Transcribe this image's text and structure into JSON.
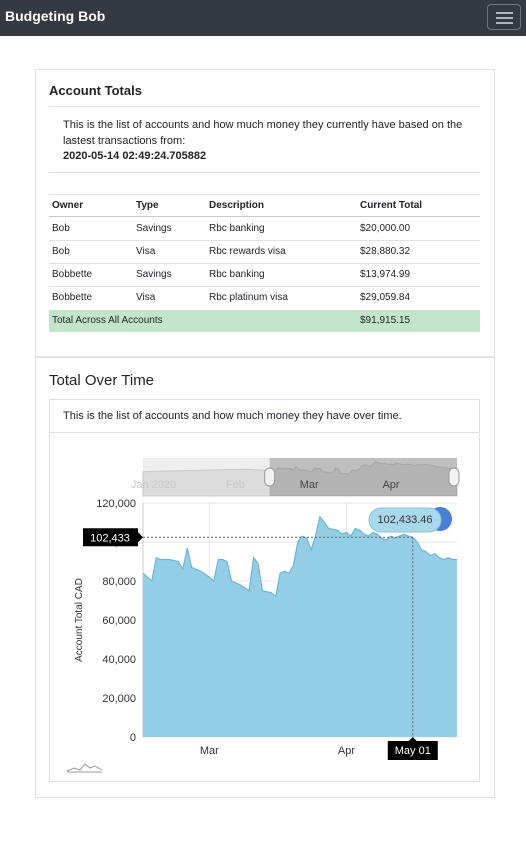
{
  "navbar": {
    "brand": "Budgeting Bob",
    "menu_icon": "hamburger-menu-icon"
  },
  "accounts": {
    "title": "Account Totals",
    "intro": "This is the list of accounts and how much money they currently have based on the lastest transactions from:",
    "timestamp": "2020-05-14 02:49:24.705882",
    "columns": [
      "Owner",
      "Type",
      "Description",
      "Current Total"
    ],
    "rows": [
      {
        "owner": "Bob",
        "type": "Savings",
        "description": "Rbc banking",
        "total": "$20,000.00"
      },
      {
        "owner": "Bob",
        "type": "Visa",
        "description": "Rbc rewards visa",
        "total": "$28,880.32"
      },
      {
        "owner": "Bobbette",
        "type": "Savings",
        "description": "Rbc banking",
        "total": "$13,974.99"
      },
      {
        "owner": "Bobbette",
        "type": "Visa",
        "description": "Rbc platinum visa",
        "total": "$29,059.84"
      }
    ],
    "total_label": "Total Across All Accounts",
    "total_value": "$91,915.15",
    "total_color": "#c3e6cb"
  },
  "overtime": {
    "title": "Total Over Time",
    "intro": "This is the list of accounts and how much money they have over time."
  },
  "chart_data": {
    "type": "area",
    "ylabel": "Account Total CAD",
    "xlabel": "",
    "yticks": [
      "120,000",
      "100,000",
      "80,000",
      "60,000",
      "40,000",
      "20,000",
      "0"
    ],
    "ylim": [
      0,
      120000
    ],
    "xtick_labels": [
      {
        "label": "Mar",
        "day": 35
      },
      {
        "label": "Apr",
        "day": 66
      }
    ],
    "navigator_labels": [
      {
        "label": "Jan 2020",
        "day": -24
      },
      {
        "label": "Feb",
        "day": 7
      },
      {
        "label": "Mar",
        "day": 35
      },
      {
        "label": "Apr",
        "day": 66
      }
    ],
    "crosshair": {
      "y_label": "102,433",
      "x_label": "May 01",
      "tooltip": "102,433.46",
      "day": 81
    },
    "fill_color": "#94cee6",
    "line_color": "#6bb6d8",
    "grid": true,
    "series": [
      {
        "points": [
          [
            20,
            84000
          ],
          [
            21,
            82000
          ],
          [
            22,
            80000
          ],
          [
            23,
            92000
          ],
          [
            24,
            91000
          ],
          [
            26,
            91000
          ],
          [
            28,
            90000
          ],
          [
            29,
            86000
          ],
          [
            30,
            97000
          ],
          [
            31,
            87000
          ],
          [
            33,
            85000
          ],
          [
            35,
            82000
          ],
          [
            36,
            80000
          ],
          [
            37,
            91000
          ],
          [
            38,
            91000
          ],
          [
            39,
            90000
          ],
          [
            40,
            80000
          ],
          [
            42,
            78000
          ],
          [
            44,
            75000
          ],
          [
            45,
            92000
          ],
          [
            46,
            89000
          ],
          [
            47,
            75000
          ],
          [
            49,
            74000
          ],
          [
            50,
            72000
          ],
          [
            51,
            84000
          ],
          [
            52,
            85000
          ],
          [
            53,
            84000
          ],
          [
            54,
            88000
          ],
          [
            55,
            100000
          ],
          [
            56,
            103000
          ],
          [
            57,
            102000
          ],
          [
            58,
            96000
          ],
          [
            59,
            103000
          ],
          [
            60,
            113000
          ],
          [
            61,
            110000
          ],
          [
            62,
            107000
          ],
          [
            64,
            106000
          ],
          [
            65,
            104000
          ],
          [
            66,
            105000
          ],
          [
            67,
            103000
          ],
          [
            68,
            107000
          ],
          [
            69,
            106000
          ],
          [
            70,
            104000
          ],
          [
            71,
            103000
          ],
          [
            72,
            105000
          ],
          [
            73,
            104000
          ],
          [
            74,
            102000
          ],
          [
            75,
            101000
          ],
          [
            76,
            103000
          ],
          [
            77,
            102000
          ],
          [
            78,
            103000
          ],
          [
            79,
            104000
          ],
          [
            80,
            103000
          ],
          [
            81,
            102433
          ],
          [
            82,
            100000
          ],
          [
            83,
            96000
          ],
          [
            84,
            95000
          ],
          [
            85,
            93000
          ],
          [
            86,
            94000
          ],
          [
            87,
            92000
          ],
          [
            88,
            91000
          ],
          [
            89,
            92000
          ],
          [
            90,
            91000
          ],
          [
            91,
            91000
          ]
        ]
      }
    ]
  }
}
